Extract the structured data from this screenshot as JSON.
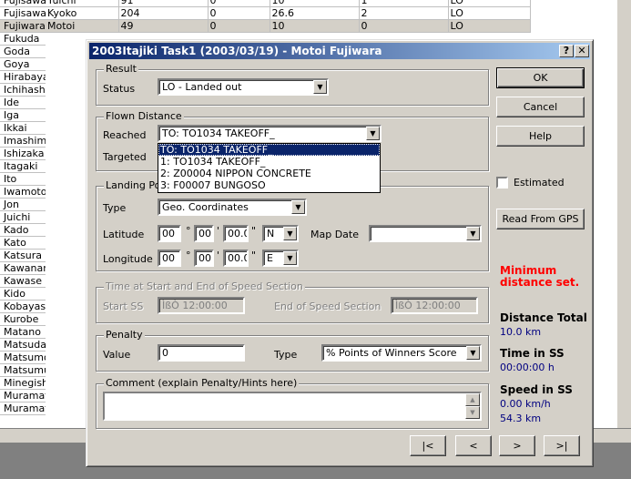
{
  "sheet": {
    "rows": [
      {
        "name": "Fujisawa",
        "first": "Yuichi",
        "c1": "91",
        "c2": "0",
        "c3": "10",
        "c4": "1",
        "c5": "LO"
      },
      {
        "name": "Fujisawa",
        "first": "Kyoko",
        "c1": "204",
        "c2": "0",
        "c3": "26.6",
        "c4": "2",
        "c5": "LO"
      },
      {
        "name": "Fujiwara",
        "first": "Motoi",
        "c1": "49",
        "c2": "0",
        "c3": "10",
        "c4": "0",
        "c5": "LO"
      }
    ],
    "names": [
      "Fujisawa",
      "Fujisawa",
      "Fujiwara",
      "Fukuda",
      "Goda",
      "Goya",
      "Hirabaya",
      "Ichihash",
      "Ide",
      "Iga",
      "Ikkai",
      "Imashima",
      "Ishizaka",
      "Itagaki",
      "Ito",
      "Iwamoto",
      "Jon",
      "Juichi",
      "Kado",
      "Kato",
      "Katsura",
      "Kawanan",
      "Kawase",
      "Kido",
      "Kobayas",
      "Kurobe",
      "Matano",
      "Matsuda",
      "Matsumo",
      "Matsumu",
      "Minegish",
      "Muramat",
      "Muramat"
    ]
  },
  "dialog": {
    "title": "2003Itajiki Task1 (2003/03/19) - Motoi Fujiwara",
    "help_btn": "?",
    "close_btn": "✕",
    "result": {
      "group": "Result",
      "status_label": "Status",
      "status_value": "LO - Landed out"
    },
    "flown": {
      "group": "Flown Distance",
      "reached_label": "Reached",
      "reached_value": "TO: TO1034 TAKEOFF_",
      "targeted_label": "Targeted",
      "options": [
        "TO: TO1034 TAKEOFF_",
        "1: TO1034 TAKEOFF_",
        "2: Z00004 NIPPON CONCRETE",
        "3: F00007 BUNGOSO"
      ]
    },
    "landing": {
      "group": "Landing Point",
      "type_label": "Type",
      "type_value": "Geo. Coordinates",
      "lat_label": "Latitude",
      "lat_deg": "00",
      "lat_min": "00",
      "lat_sec": "00.0",
      "lat_dir": "N",
      "lon_label": "Longitude",
      "lon_deg": "00",
      "lon_min": "00",
      "lon_sec": "00.0",
      "lon_dir": "E",
      "deg_sym": "°",
      "min_sym": "'",
      "sec_sym": "\"",
      "map_date_label": "Map Date",
      "map_date_value": ""
    },
    "time": {
      "group": "Time at Start and End of Speed Section",
      "start_label": "Start SS",
      "start_value": "ÌßÒ 12:00:00",
      "end_label": "End of Speed Section",
      "end_value": "ÌßÒ 12:00:00"
    },
    "penalty": {
      "group": "Penalty",
      "value_label": "Value",
      "value": "0",
      "type_label": "Type",
      "type_value": "% Points of Winners Score"
    },
    "comment": {
      "group": "Comment (explain Penalty/Hints here)",
      "value": ""
    },
    "buttons": {
      "ok": "OK",
      "cancel": "Cancel",
      "help": "Help",
      "estimated": "Estimated",
      "gps": "Read From GPS"
    },
    "warning": "Minimum distance set.",
    "stats": {
      "distance_title": "Distance Total",
      "distance_value": "10.0 km",
      "time_title": "Time in SS",
      "time_value": "00:00:00 h",
      "speed_title": "Speed in SS",
      "speed_value": "0.00 km/h",
      "extra_value": "54.3 km"
    },
    "nav": {
      "first": "|<",
      "prev": "<",
      "next": ">",
      "last": ">|"
    }
  }
}
